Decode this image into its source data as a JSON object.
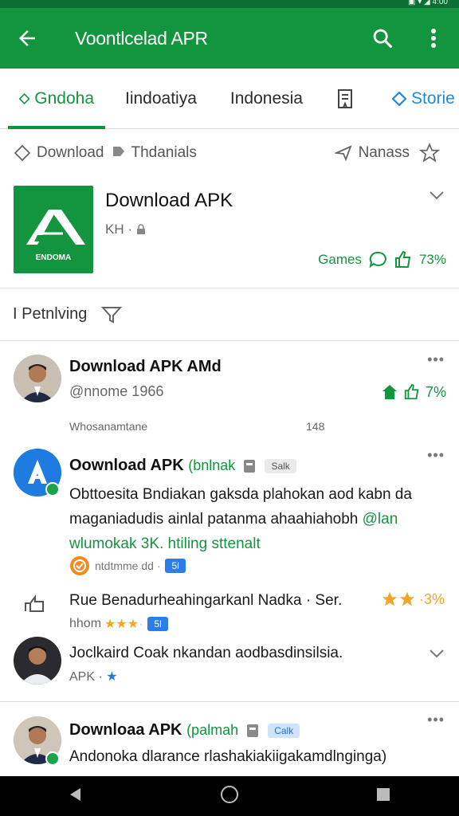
{
  "status_bar": {
    "text": "▣ ▾ ◢ 4:00"
  },
  "app_bar": {
    "title": "Voontlcelad APR"
  },
  "tabs": [
    {
      "label": "Gndoha"
    },
    {
      "label": "Iindoatiya"
    },
    {
      "label": "Indonesia"
    },
    {
      "label": "Storie"
    }
  ],
  "crumbs": {
    "left1": "Download",
    "left2": "Thdanials",
    "right": "Nanass"
  },
  "app": {
    "name": "Download APK",
    "meta": "KH ·",
    "logo_text": "ENDOMA",
    "category": "Games",
    "percent": "73%"
  },
  "filter": {
    "label": "I Petnlving"
  },
  "feed": {
    "item1": {
      "title": "Download APK AMd",
      "sub": "@nnome 1966",
      "percent": "7%",
      "footer_left": "Whosanamtane",
      "footer_right": "148"
    },
    "item2": {
      "title": "Oownload APK",
      "tag": "(bnlnak",
      "chip": "Salk",
      "body1": "Obttoesita Bndiakan gaksda plahokan aod kabn da",
      "body2_a": "maganiadudis ainlal patanma ahaahiahobh ",
      "body2_b": "@lan",
      "body3": "wlumokak 3K. htiling sttenalt",
      "meta": "ntdtmme dd ·",
      "meta_badge": "5l"
    },
    "item3": {
      "text": "Rue Benadurheahingarkanl Nadka · Ser.",
      "percent": "·3%",
      "sub": "hhom",
      "badge": "5l"
    },
    "item4": {
      "text": "Joclkaird Coak nkandan aodbasdinsilsia.",
      "sub": "APK ·"
    },
    "item5": {
      "title": "Downloaa APK",
      "tag": "(palmah",
      "chip": "Calk",
      "body1": "Andonoka dlarance rlashakiakiigakamdlnginga)"
    }
  }
}
